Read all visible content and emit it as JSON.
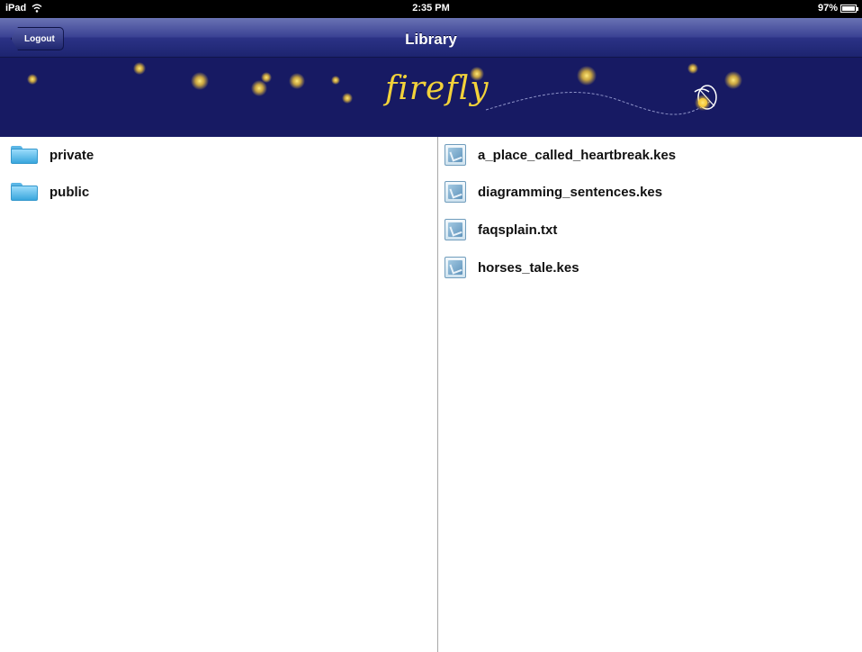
{
  "status_bar": {
    "device": "iPad",
    "time": "2:35 PM",
    "battery": "97%"
  },
  "nav": {
    "back_label": "Logout",
    "title": "Library"
  },
  "banner": {
    "logo": "firefly"
  },
  "folders": [
    {
      "label": "private",
      "icon": "folder-icon"
    },
    {
      "label": "public",
      "icon": "folder-icon"
    }
  ],
  "files": [
    {
      "label": "a_place_called_heartbreak.kes",
      "icon": "document-icon"
    },
    {
      "label": "diagramming_sentences.kes",
      "icon": "document-icon"
    },
    {
      "label": "faqsplain.txt",
      "icon": "document-icon"
    },
    {
      "label": "horses_tale.kes",
      "icon": "document-icon"
    }
  ],
  "colors": {
    "banner_bg": "#171a63",
    "logo": "#f2d23a",
    "folder": "#5bb6e6"
  }
}
